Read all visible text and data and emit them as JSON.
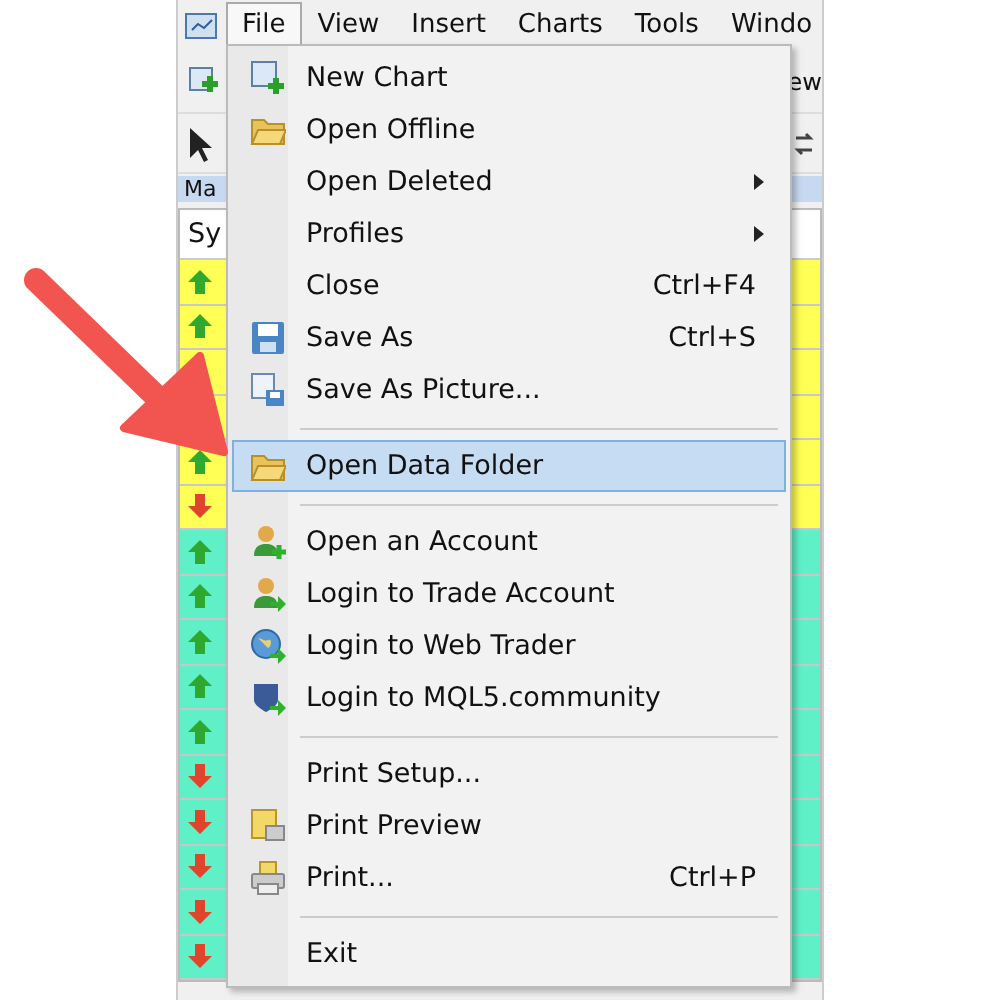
{
  "menu_bar": [
    {
      "label": "File",
      "selected": true
    },
    {
      "label": "View",
      "selected": false
    },
    {
      "label": "Insert",
      "selected": false
    },
    {
      "label": "Charts",
      "selected": false
    },
    {
      "label": "Tools",
      "selected": false
    },
    {
      "label": "Windo",
      "selected": false
    }
  ],
  "toolbar": {
    "text": "ew"
  },
  "market_watch": {
    "title": "Ma",
    "column_1": "Sy",
    "rows": [
      {
        "kind": "up",
        "color": "#ffff55"
      },
      {
        "kind": "up",
        "color": "#ffff55"
      },
      {
        "kind": "blank",
        "color": "#ffff55"
      },
      {
        "kind": "blank",
        "color": "#ffff55"
      },
      {
        "kind": "up",
        "color": "#ffff55"
      },
      {
        "kind": "down",
        "color": "#ffff55"
      },
      {
        "kind": "up",
        "color": "#5ff0c8"
      },
      {
        "kind": "up",
        "color": "#5ff0c8"
      },
      {
        "kind": "up",
        "color": "#5ff0c8"
      },
      {
        "kind": "up",
        "color": "#5ff0c8"
      },
      {
        "kind": "up",
        "color": "#5ff0c8"
      },
      {
        "kind": "down",
        "color": "#5ff0c8"
      },
      {
        "kind": "down",
        "color": "#5ff0c8"
      },
      {
        "kind": "down",
        "color": "#5ff0c8"
      },
      {
        "kind": "down",
        "color": "#5ff0c8"
      },
      {
        "kind": "down",
        "color": "#5ff0c8"
      }
    ]
  },
  "file_menu": [
    {
      "kind": "chart",
      "label": "New Chart",
      "selected": false
    },
    {
      "kind": "folder",
      "label": "Open Offline",
      "selected": false
    },
    {
      "kind": "plain",
      "label": "Open Deleted",
      "submenu": true,
      "selected": false
    },
    {
      "kind": "plain",
      "label": "Profiles",
      "submenu": true,
      "selected": false
    },
    {
      "kind": "plain",
      "label": "Close",
      "shortcut": "Ctrl+F4",
      "selected": false
    },
    {
      "kind": "floppy",
      "label": "Save As",
      "shortcut": "Ctrl+S",
      "selected": false
    },
    {
      "kind": "snapshot",
      "label": "Save As Picture...",
      "selected": false
    },
    {
      "kind": "separator"
    },
    {
      "kind": "folder",
      "label": "Open Data Folder",
      "selected": true
    },
    {
      "kind": "separator"
    },
    {
      "kind": "signup",
      "label": "Open an Account",
      "selected": false
    },
    {
      "kind": "login",
      "label": "Login to Trade Account",
      "selected": false
    },
    {
      "kind": "web",
      "label": "Login to Web Trader",
      "selected": false
    },
    {
      "kind": "community",
      "label": "Login to MQL5.community",
      "selected": false
    },
    {
      "kind": "separator"
    },
    {
      "kind": "plain",
      "label": "Print Setup...",
      "selected": false
    },
    {
      "kind": "preview",
      "label": "Print Preview",
      "selected": false
    },
    {
      "kind": "printer",
      "label": "Print...",
      "shortcut": "Ctrl+P",
      "selected": false
    },
    {
      "kind": "separator"
    },
    {
      "kind": "plain",
      "label": "Exit",
      "selected": false
    }
  ]
}
